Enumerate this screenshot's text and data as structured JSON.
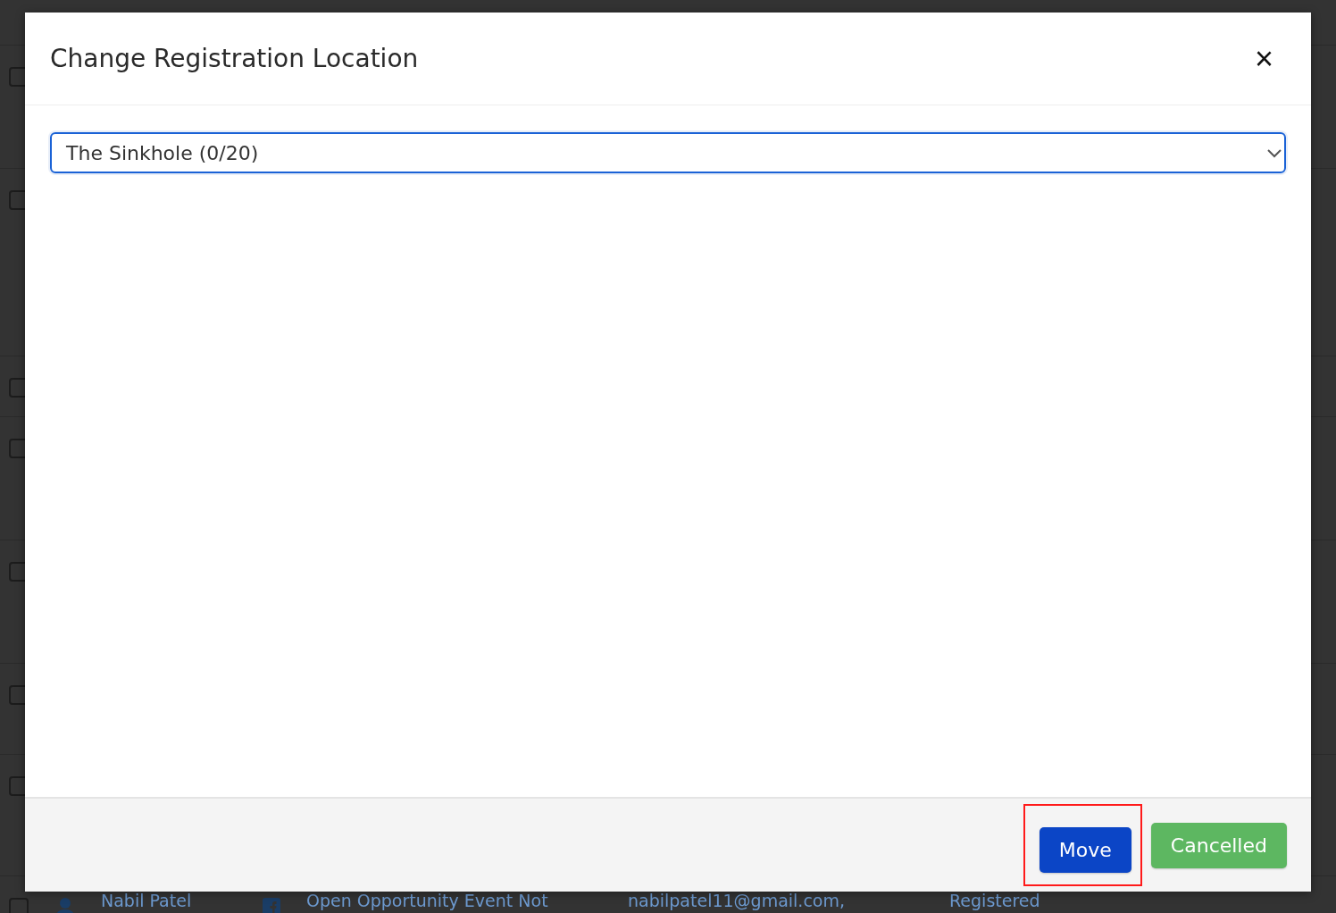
{
  "table": {
    "rows": [
      {
        "checked": false
      },
      {
        "checked": false
      },
      {
        "checked": false
      },
      {
        "checked": false
      },
      {
        "checked": false
      },
      {
        "checked": false
      },
      {
        "checked": false
      },
      {
        "checked": false,
        "name": "Nabil Patel",
        "event": "Open Opportunity Event Not",
        "email": "nabilpatel11@gmail.com,",
        "status": "Registered"
      }
    ]
  },
  "dialog": {
    "title": "Change Registration Location",
    "close_label": "×",
    "location_select": {
      "value": "The Sinkhole (0/20)"
    },
    "buttons": [
      {
        "label": "Move",
        "kind": "primary",
        "highlighted": true
      },
      {
        "label": "Cancelled",
        "kind": "success",
        "highlighted": false
      }
    ]
  }
}
